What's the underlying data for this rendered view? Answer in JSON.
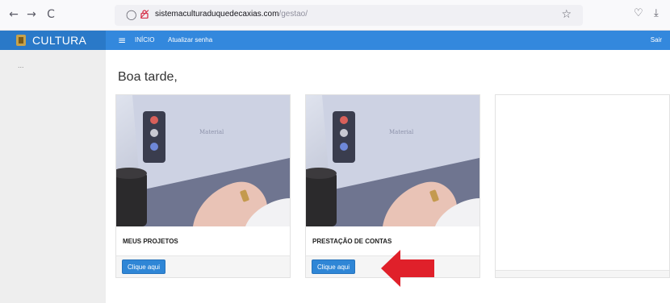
{
  "browser": {
    "nav": {
      "back": "←",
      "forward": "→",
      "reload": "C"
    },
    "url_domain": "sistemaculturaduquedecaxias.com",
    "url_path": "/gestao/",
    "shield_icon": "◯",
    "star_icon": "☆",
    "pocket_icon": "♡",
    "download_icon": "⤓"
  },
  "topbar": {
    "brand": "CULTURA",
    "menu_icon": "≡",
    "links": [
      "INÍCIO",
      "Atualizar senha"
    ],
    "logout": "Sair",
    "color": "#3388dd"
  },
  "sidebar": {
    "placeholder": "..."
  },
  "main": {
    "greeting": "Boa tarde,",
    "cards": [
      {
        "title": "MEUS PROJETOS",
        "button": "Clique aqui"
      },
      {
        "title": "PRESTAÇÃO DE CONTAS",
        "button": "Clique aqui"
      }
    ]
  },
  "annotation": {
    "arrow_color": "#e0202a"
  }
}
